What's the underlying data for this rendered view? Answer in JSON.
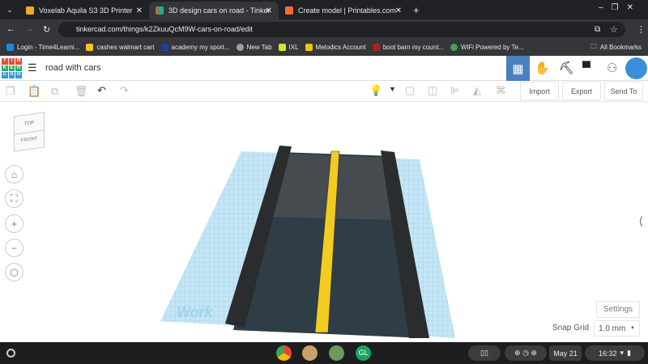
{
  "browser": {
    "tabs": [
      {
        "title": "Voxelab Aquila S3 3D Printer",
        "favicon_color": "#f5a623",
        "active": false
      },
      {
        "title": "3D design cars on road - Tinker",
        "favicon_color": "#e74c3c",
        "active": true
      },
      {
        "title": "Create model | Printables.com",
        "favicon_color": "#fa6831",
        "active": false
      }
    ],
    "url": "tinkercad.com/things/k2ZkuuQcM9W-cars-on-road/edit",
    "bookmarks": [
      {
        "label": "Login - Time4Learni...",
        "color": "#1e88e5"
      },
      {
        "label": "cashes walmart cart",
        "color": "#ffc220"
      },
      {
        "label": "academy my sport...",
        "color": "#1a3fa8"
      },
      {
        "label": "New Tab",
        "color": "#9aa0a6"
      },
      {
        "label": "IXL",
        "color": "#d8e22b"
      },
      {
        "label": "Melodics Account",
        "color": "#f5c400"
      },
      {
        "label": "boot barn my count...",
        "color": "#b71c1c"
      },
      {
        "label": "WiFi Powered by Te...",
        "color": "#34a853"
      }
    ],
    "all_bookmarks": "All Bookmarks"
  },
  "app": {
    "logo_letters": [
      "T",
      "I",
      "N",
      "K",
      "E",
      "R",
      "C",
      "A",
      "D"
    ],
    "design_title": "road with cars",
    "toolbar": {
      "import": "Import",
      "export": "Export",
      "send_to": "Send To"
    },
    "viewcube": {
      "top": "TOP",
      "front": "FRONT"
    },
    "workplane_text": "Work",
    "settings": "Settings",
    "snap_grid_label": "Snap Grid",
    "snap_grid_value": "1.0 mm",
    "accent": "#4a7fc1"
  },
  "shelf": {
    "date": "May 21",
    "time": "16:32"
  }
}
